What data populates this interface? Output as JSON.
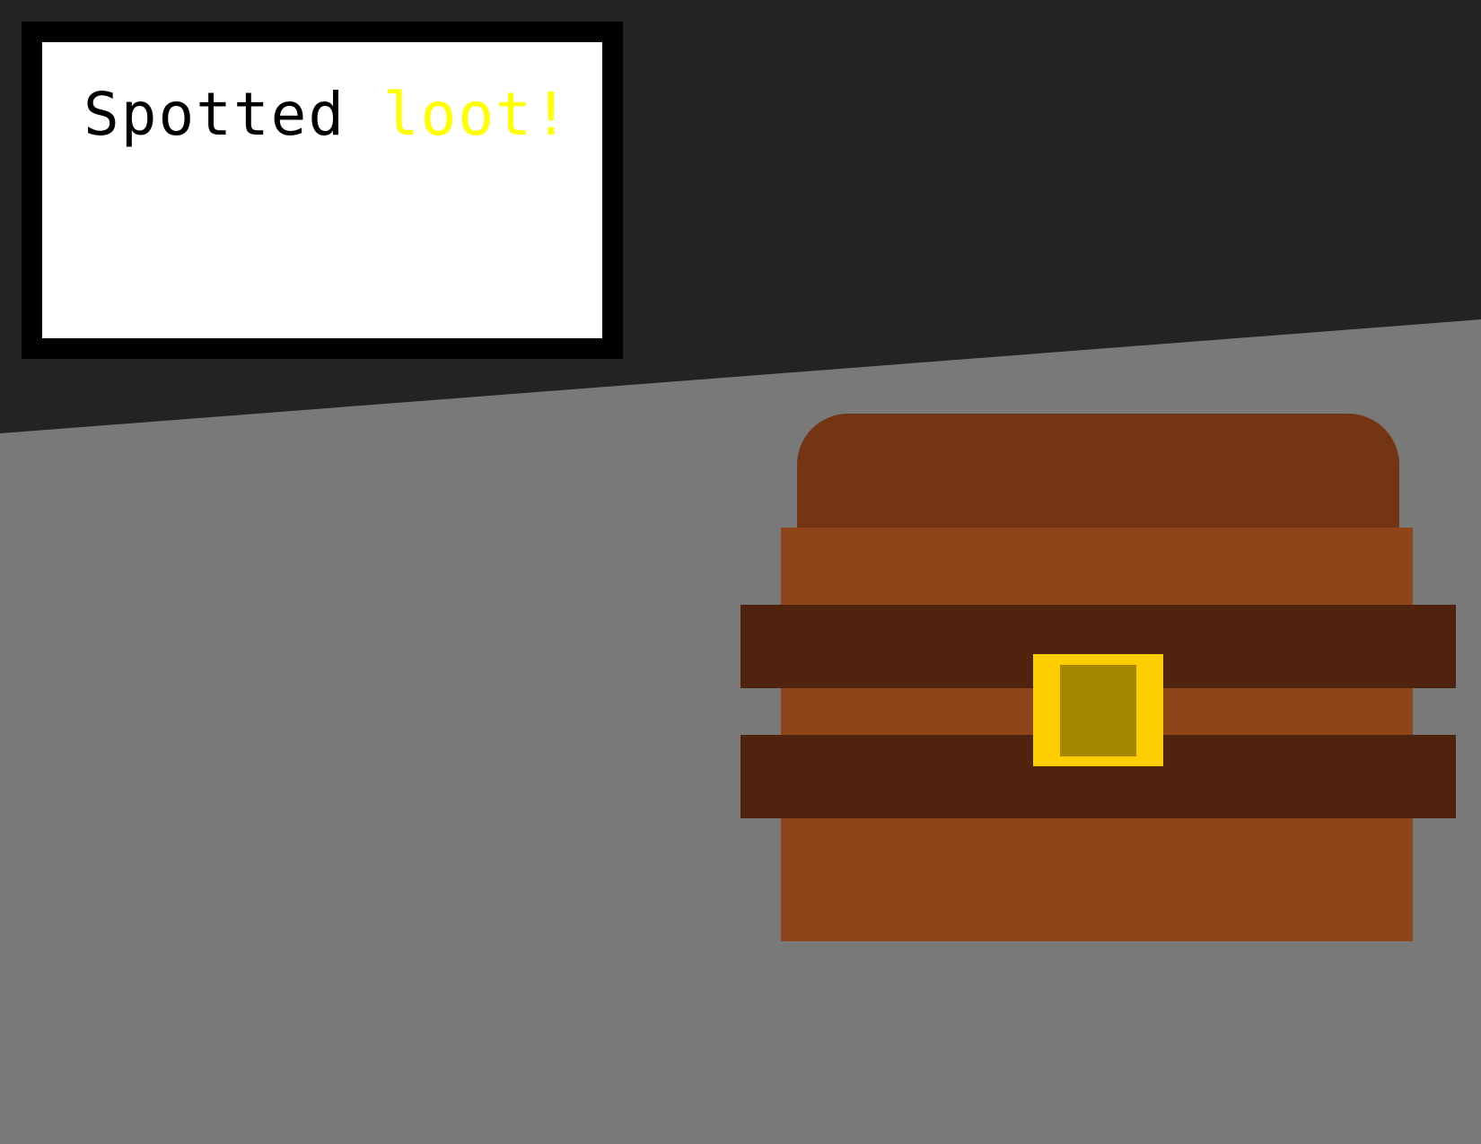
{
  "dialog": {
    "prefix": "Spotted",
    "highlight": "loot!"
  },
  "colors": {
    "wall": "#232323",
    "floor": "#797979",
    "dialog_background": "#ffffff",
    "dialog_border": "#000000",
    "dialog_text": "#000000",
    "highlight_text": "#ffff00",
    "chest_lid": "#743514",
    "chest_body": "#8f4419",
    "chest_band": "#4f230e",
    "lock_frame": "#fccd00",
    "lock_plate": "#a68700"
  },
  "icons": {
    "chest": "treasure-chest-icon",
    "lock": "padlock-icon"
  }
}
